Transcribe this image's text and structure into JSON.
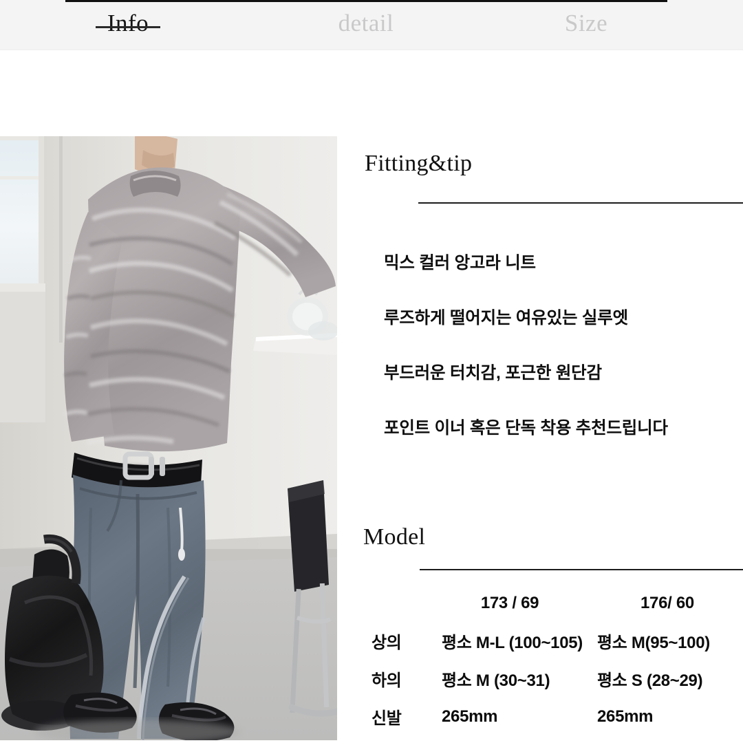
{
  "tabs": [
    {
      "label": "Info",
      "state": "active"
    },
    {
      "label": "detail",
      "state": "inactive"
    },
    {
      "label": "Size",
      "state": "inactive"
    }
  ],
  "photo": {
    "alt": "model-wearing-gray-angora-knit-and-wide-denim-jeans-holding-black-bag"
  },
  "fitting": {
    "title": "Fitting&tip",
    "bullets": [
      "믹스 컬러 앙고라 니트",
      "루즈하게 떨어지는 여유있는 실루엣",
      "부드러운 터치감, 포근한 원단감",
      "포인트 이너 혹은 단독 착용 추천드립니다"
    ]
  },
  "model": {
    "title": "Model",
    "columns": [
      "",
      "173 / 69",
      "176/ 60"
    ],
    "rows": [
      {
        "label": "상의",
        "a": "평소 M-L (100~105)",
        "b": "평소 M(95~100)"
      },
      {
        "label": "하의",
        "a": "평소 M (30~31)",
        "b": "평소 S (28~29)"
      },
      {
        "label": "신발",
        "a": "265mm",
        "b": "265mm"
      }
    ]
  },
  "colors": {
    "tabbar_bg": "#f4f4f5",
    "active_tab": "#141414",
    "inactive_tab": "#c9c9ca",
    "rule": "#1c1c1c",
    "text": "#0e0e0e",
    "page_bg": "#ffffff"
  }
}
